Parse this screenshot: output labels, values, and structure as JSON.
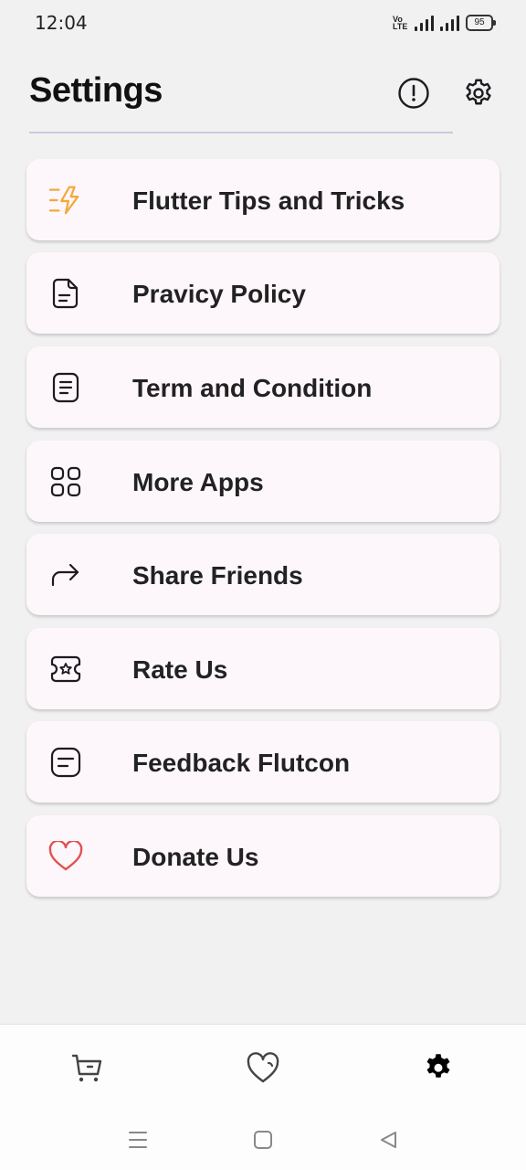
{
  "status_bar": {
    "time": "12:04",
    "volte_line1": "Vo",
    "volte_line2": "LTE",
    "battery": "95"
  },
  "header": {
    "title": "Settings",
    "info_icon": "info-icon",
    "settings_icon": "gear-icon"
  },
  "menu_items": [
    {
      "label": "Flutter Tips and Tricks",
      "icon": "bolt-icon",
      "icon_color": "#f2a93b"
    },
    {
      "label": "Pravicy Policy",
      "icon": "document-icon",
      "icon_color": "#1d1b20"
    },
    {
      "label": "Term and Condition",
      "icon": "terms-icon",
      "icon_color": "#1d1b20"
    },
    {
      "label": "More Apps",
      "icon": "grid-icon",
      "icon_color": "#1d1b20"
    },
    {
      "label": "Share Friends",
      "icon": "share-icon",
      "icon_color": "#1d1b20"
    },
    {
      "label": "Rate Us",
      "icon": "ticket-star-icon",
      "icon_color": "#1d1b20"
    },
    {
      "label": "Feedback Flutcon",
      "icon": "feedback-icon",
      "icon_color": "#1d1b20"
    },
    {
      "label": "Donate Us",
      "icon": "heart-icon",
      "icon_color": "#e05252"
    }
  ],
  "bottom_nav": [
    {
      "icon": "cart-icon",
      "active": false
    },
    {
      "icon": "heart-icon",
      "active": false
    },
    {
      "icon": "gear-icon",
      "active": true
    }
  ],
  "system_nav": [
    "menu-icon",
    "home-square-icon",
    "back-triangle-icon"
  ]
}
